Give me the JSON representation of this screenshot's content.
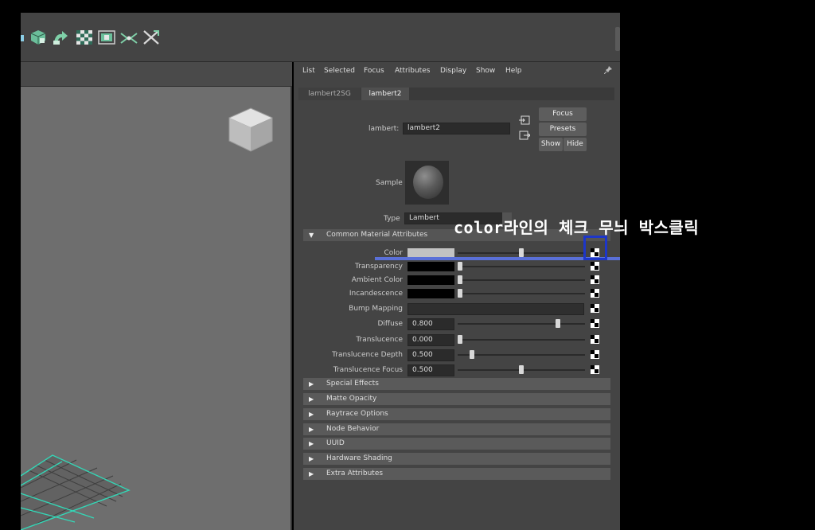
{
  "menubar": [
    "List",
    "Selected",
    "Focus",
    "Attributes",
    "Display",
    "Show",
    "Help"
  ],
  "tabs": [
    {
      "label": "lambert2SG",
      "active": false
    },
    {
      "label": "lambert2",
      "active": true
    }
  ],
  "node": {
    "type_label": "lambert:",
    "name": "lambert2",
    "buttons": {
      "focus": "Focus",
      "presets": "Presets",
      "show": "Show",
      "hide": "Hide"
    }
  },
  "sample_label": "Sample",
  "type_row": {
    "label": "Type",
    "value": "Lambert"
  },
  "common_section": "Common Material Attributes",
  "attributes": [
    {
      "label": "Color",
      "kind": "color",
      "swatch": "#c2c2c2",
      "slider": 0.5
    },
    {
      "label": "Transparency",
      "kind": "color",
      "swatch": "#000000",
      "slider": 0.0
    },
    {
      "label": "Ambient Color",
      "kind": "color",
      "swatch": "#000000",
      "slider": 0.0
    },
    {
      "label": "Incandescence",
      "kind": "color",
      "swatch": "#000000",
      "slider": 0.0
    },
    {
      "label": "Bump Mapping",
      "kind": "map"
    },
    {
      "label": "Diffuse",
      "kind": "number",
      "value": "0.800",
      "slider": 0.8
    },
    {
      "label": "Translucence",
      "kind": "number",
      "value": "0.000",
      "slider": 0.0
    },
    {
      "label": "Translucence Depth",
      "kind": "number",
      "value": "0.500",
      "slider": 0.1
    },
    {
      "label": "Translucence Focus",
      "kind": "number",
      "value": "0.500",
      "slider": 0.5
    }
  ],
  "collapsed_sections": [
    "Special Effects",
    "Matte Opacity",
    "Raytrace Options",
    "Node Behavior",
    "UUID",
    "Hardware Shading",
    "Extra Attributes"
  ],
  "annotation": {
    "text": "color라인의 체크 무늬 박스클릭",
    "color": "#1d36c9"
  },
  "icons": [
    "cube-icon",
    "bend-icon",
    "checker-map-icon",
    "render-icon",
    "joint-icon",
    "cross-tools-icon"
  ],
  "colors": {
    "panel": "#444444",
    "viewport": "#6e6e6e",
    "grid_highlight": "#34d6b6"
  }
}
